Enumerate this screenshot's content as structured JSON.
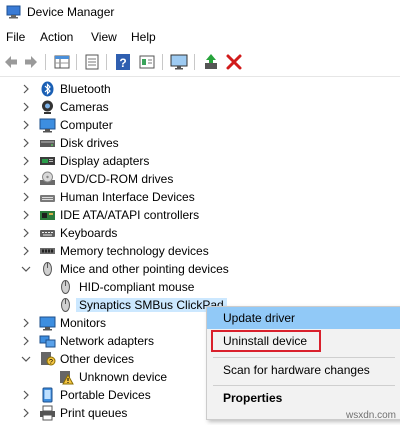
{
  "window": {
    "title": "Device Manager"
  },
  "menu": [
    "File",
    "Action",
    "View",
    "Help"
  ],
  "toolbar": {
    "icons": [
      "back-arrow-icon",
      "forward-arrow-icon",
      "properties-grid-icon",
      "document-icon",
      "help-icon",
      "view-icon",
      "monitor-scan-icon",
      "update-driver-icon",
      "uninstall-x-icon"
    ]
  },
  "tree": {
    "categories": [
      {
        "label": "Bluetooth",
        "icon": "bluetooth-icon",
        "expanded": false
      },
      {
        "label": "Cameras",
        "icon": "camera-icon",
        "expanded": false
      },
      {
        "label": "Computer",
        "icon": "computer-icon",
        "expanded": false
      },
      {
        "label": "Disk drives",
        "icon": "disk-drive-icon",
        "expanded": false
      },
      {
        "label": "Display adapters",
        "icon": "display-adapter-icon",
        "expanded": false
      },
      {
        "label": "DVD/CD-ROM drives",
        "icon": "dvd-drive-icon",
        "expanded": false
      },
      {
        "label": "Human Interface Devices",
        "icon": "hid-icon",
        "expanded": false
      },
      {
        "label": "IDE ATA/ATAPI controllers",
        "icon": "ide-controller-icon",
        "expanded": false
      },
      {
        "label": "Keyboards",
        "icon": "keyboard-icon",
        "expanded": false
      },
      {
        "label": "Memory technology devices",
        "icon": "memory-icon",
        "expanded": false
      },
      {
        "label": "Mice and other pointing devices",
        "icon": "mouse-icon",
        "expanded": true,
        "children": [
          "HID-compliant mouse",
          "Synaptics SMBus ClickPad"
        ]
      },
      {
        "label": "Monitors",
        "icon": "monitor-icon",
        "expanded": false
      },
      {
        "label": "Network adapters",
        "icon": "network-adapter-icon",
        "expanded": false
      },
      {
        "label": "Other devices",
        "icon": "other-devices-icon",
        "expanded": true,
        "children": [
          "Unknown device"
        ]
      },
      {
        "label": "Portable Devices",
        "icon": "portable-device-icon",
        "expanded": false
      },
      {
        "label": "Print queues",
        "icon": "printer-icon",
        "expanded": false
      }
    ]
  },
  "context_menu": {
    "items": [
      "Update driver",
      "Uninstall device",
      "Scan for hardware changes",
      "Properties"
    ],
    "highlighted": "Uninstall device",
    "hovered": "Update driver",
    "highlight_color": "#d9202c",
    "hover_color": "#91c9f7"
  },
  "watermark": "wsxdn.com"
}
